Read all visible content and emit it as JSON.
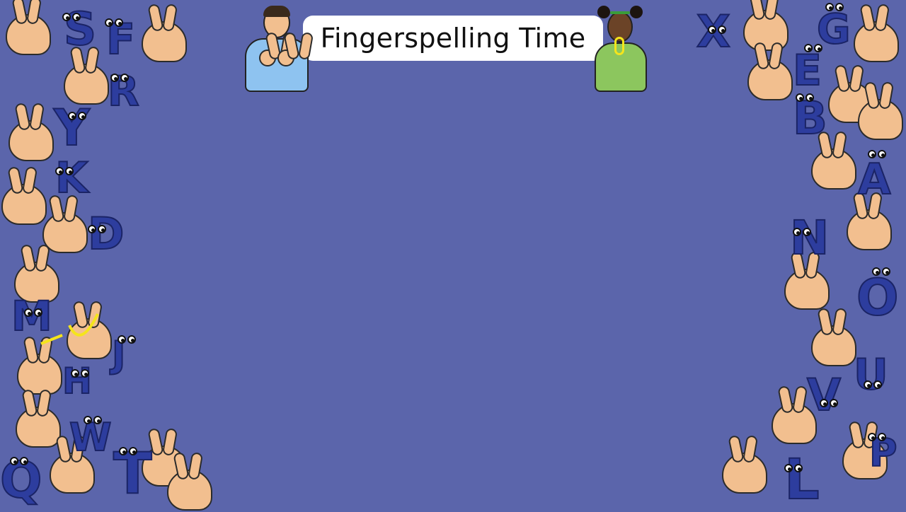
{
  "title": "Fingerspelling Time",
  "colors": {
    "background": "#5b65ab",
    "letter": "#2d3d9e",
    "skin": "#f2bf8f",
    "boy_shirt": "#8ec3f0",
    "girl_shirt": "#8cc65e",
    "motion_arrow": "#f5e51b"
  },
  "left_letters": [
    "S",
    "F",
    "R",
    "Y",
    "K",
    "D",
    "M",
    "J",
    "H",
    "W",
    "Q",
    "T"
  ],
  "right_letters": [
    "X",
    "G",
    "E",
    "B",
    "A",
    "N",
    "O",
    "U",
    "V",
    "P",
    "L"
  ],
  "characters": [
    "boy-signer",
    "girl-signer"
  ]
}
